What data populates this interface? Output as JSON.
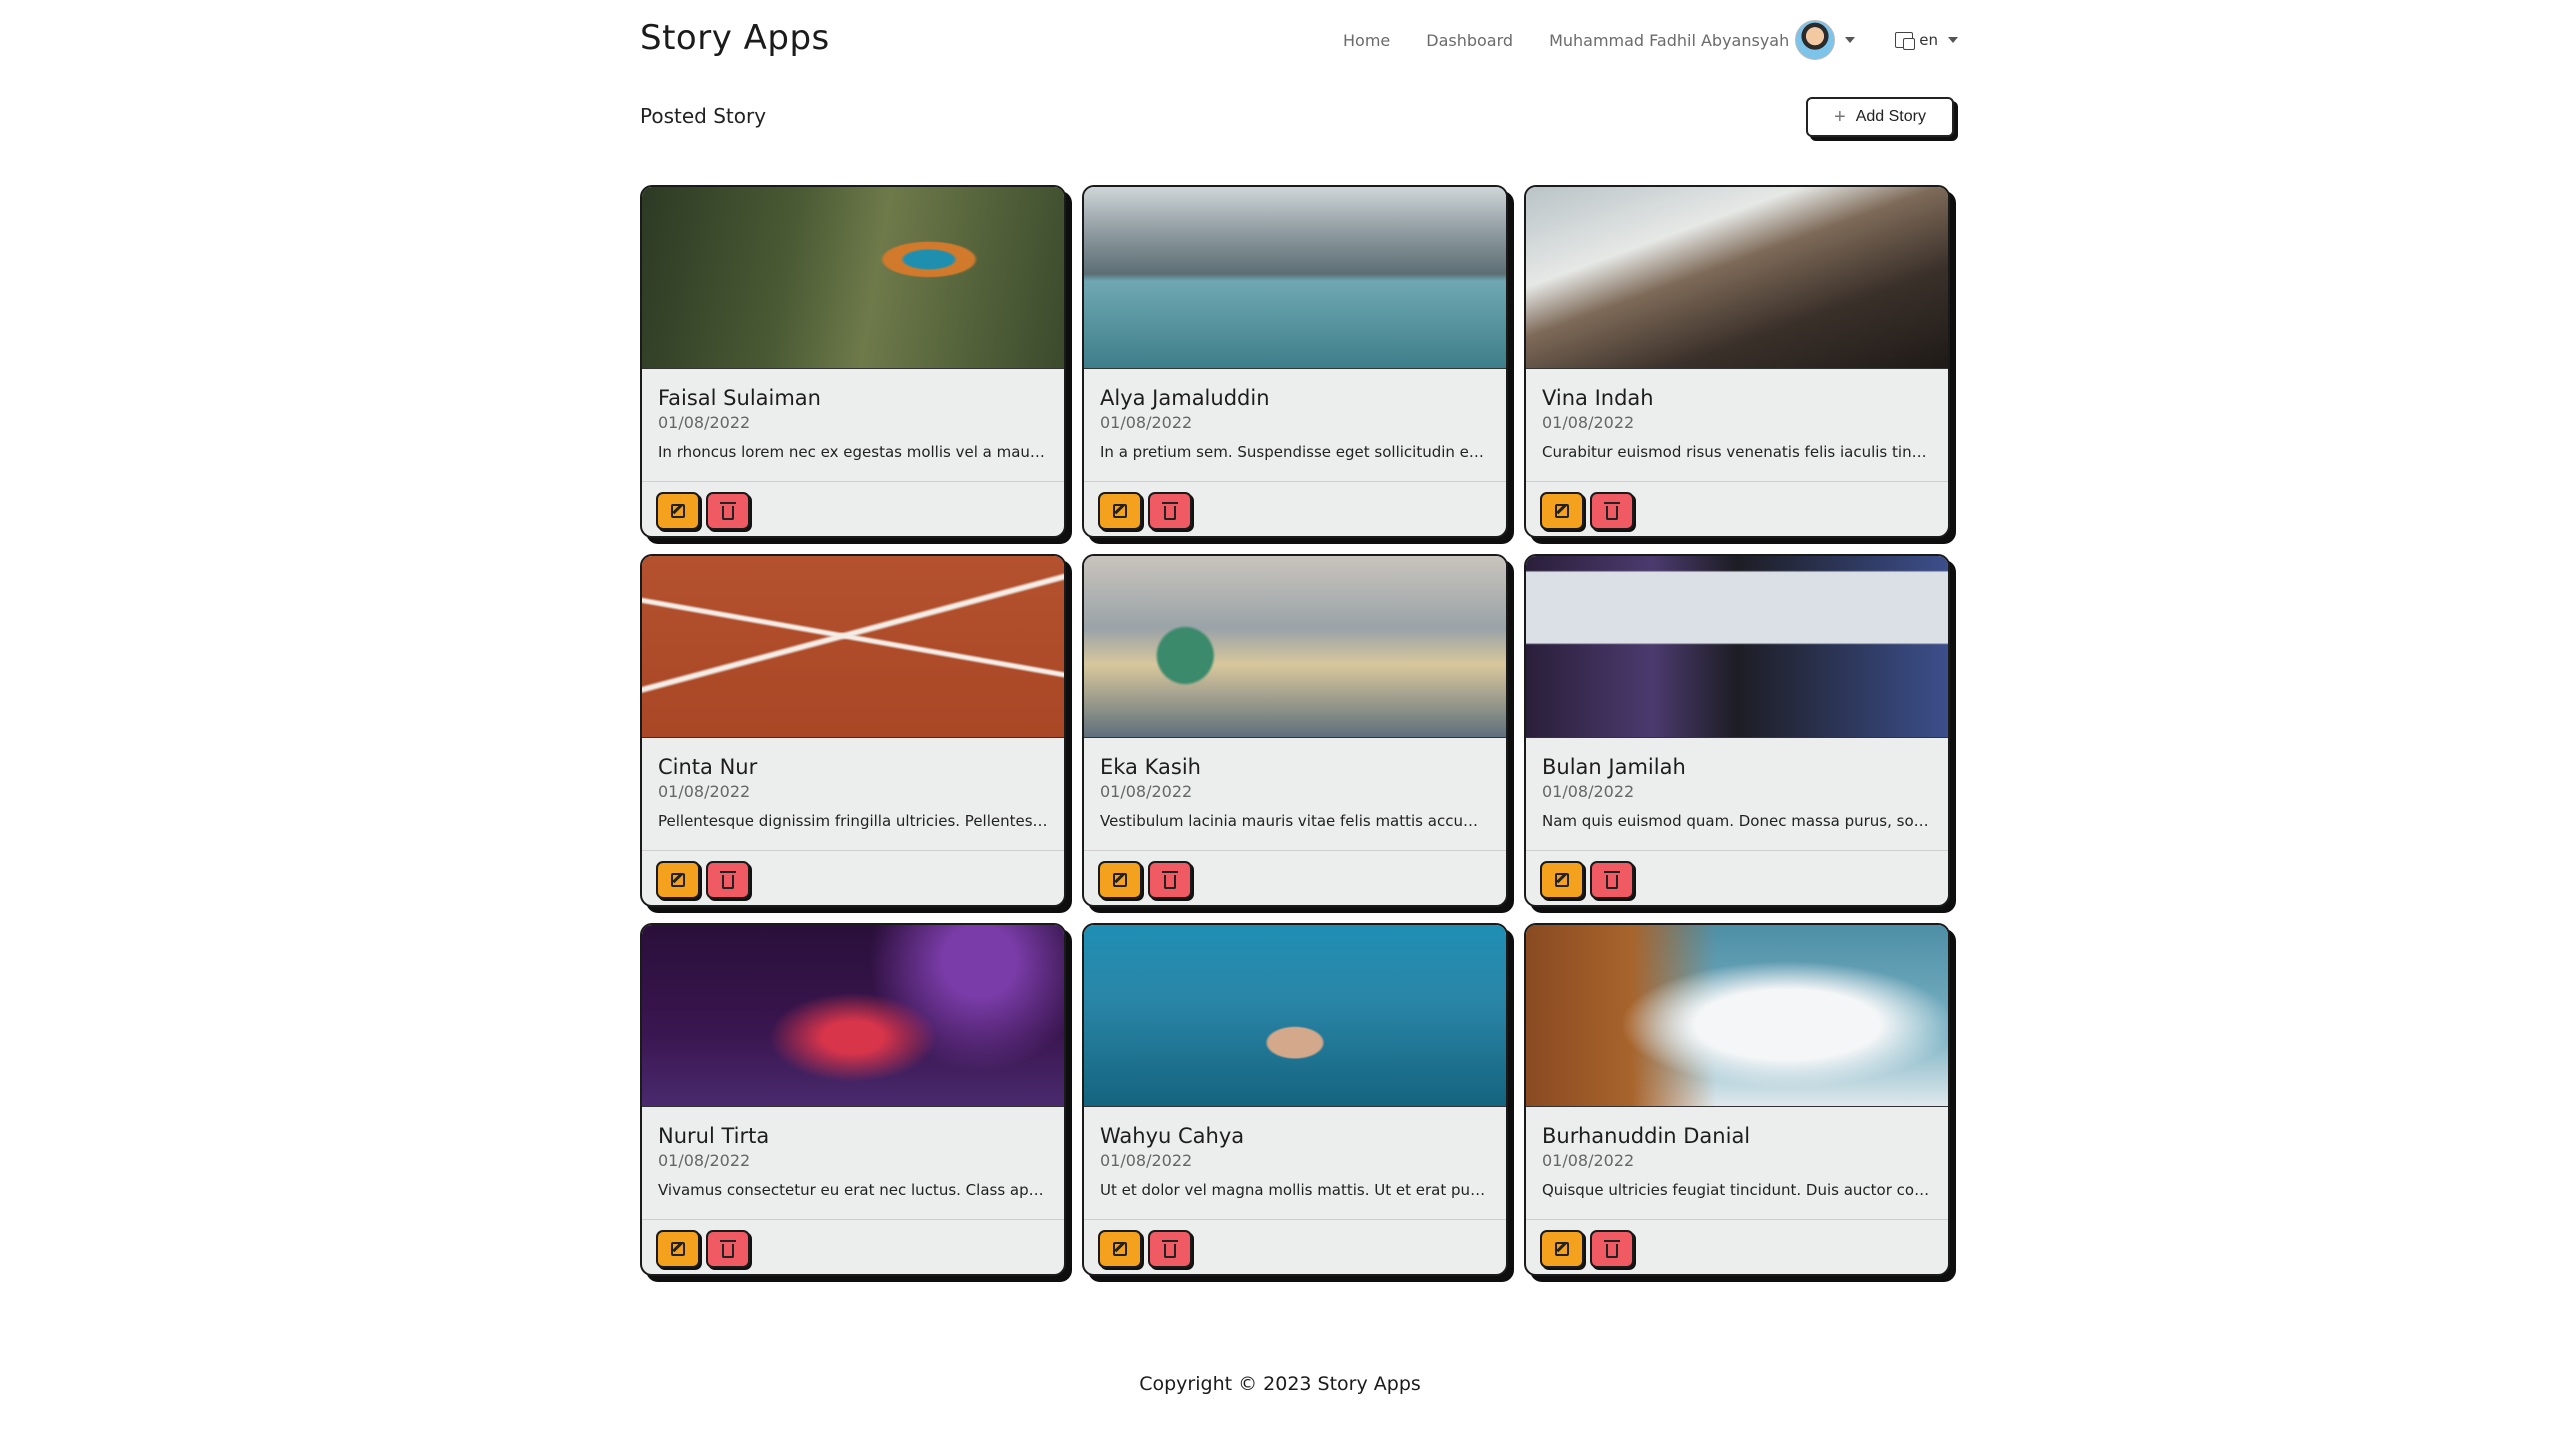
{
  "header": {
    "brand": "Story Apps",
    "nav": {
      "home": "Home",
      "dashboard": "Dashboard"
    },
    "user_name": "Muhammad Fadhil Abyansyah",
    "language": "en"
  },
  "page": {
    "section_title": "Posted Story",
    "add_button_icon": "+",
    "add_button_label": "Add Story"
  },
  "icons": {
    "edit": "pencil-square-icon",
    "delete": "trash-icon",
    "language": "translate-icon",
    "dropdown": "caret-down-icon"
  },
  "colors": {
    "edit_button": "#f4a21d",
    "delete_button": "#f05a62"
  },
  "stories": [
    {
      "name": "Faisal Sulaiman",
      "date": "01/08/2022",
      "text": "In rhoncus lorem nec ex egestas mollis vel a mauris.",
      "image": "kingfisher on branch"
    },
    {
      "name": "Alya Jamaluddin",
      "date": "01/08/2022",
      "text": "In a pretium sem. Suspendisse eget sollicitudin enim.",
      "image": "mountain lake"
    },
    {
      "name": "Vina Indah",
      "date": "01/08/2022",
      "text": "Curabitur euismod risus venenatis felis iaculis tincidunt.",
      "image": "hiker on mountain peak"
    },
    {
      "name": "Cinta Nur",
      "date": "01/08/2022",
      "text": "Pellentesque dignissim fringilla ultricies. Pellentesque habitant.",
      "image": "clay tennis court"
    },
    {
      "name": "Eka Kasih",
      "date": "01/08/2022",
      "text": "Vestibulum lacinia mauris vitae felis mattis accumsan.",
      "image": "football kick"
    },
    {
      "name": "Bulan Jamilah",
      "date": "01/08/2022",
      "text": "Nam quis euismod quam. Donec massa purus, sodales.",
      "image": "desk computer setup"
    },
    {
      "name": "Nurul Tirta",
      "date": "01/08/2022",
      "text": "Vivamus consectetur eu erat nec luctus. Class aptent.",
      "image": "rgb keyboard"
    },
    {
      "name": "Wahyu Cahya",
      "date": "01/08/2022",
      "text": "Ut et dolor vel magna mollis mattis. Ut et erat purus.",
      "image": "underwater diver"
    },
    {
      "name": "Burhanuddin Danial",
      "date": "01/08/2022",
      "text": "Quisque ultricies feugiat tincidunt. Duis auctor commodo.",
      "image": "clouds and autumn trees"
    }
  ],
  "footer": {
    "copyright": "Copyright © 2023 Story Apps"
  }
}
